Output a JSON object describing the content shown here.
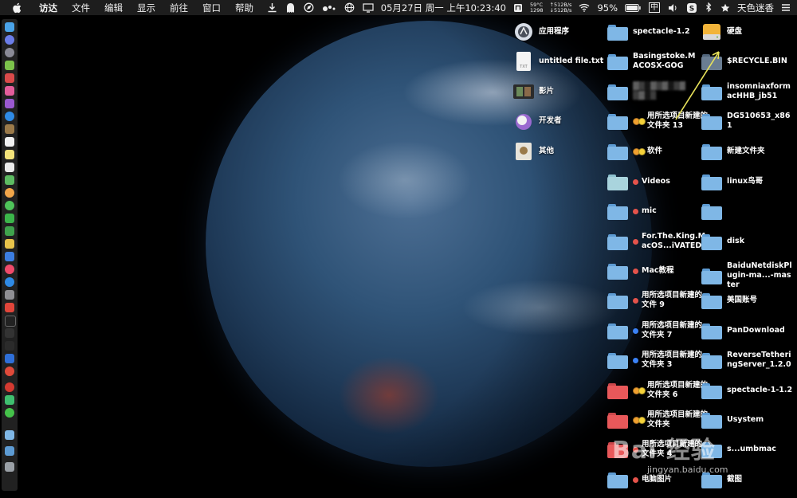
{
  "menubar": {
    "app_name": "访达",
    "menus": [
      "文件",
      "编辑",
      "显示",
      "前往",
      "窗口",
      "帮助"
    ],
    "temp_top": "59°C",
    "temp_bottom": "1298",
    "net_up": "↑512B/s",
    "net_down": "↓512B/s",
    "clock": "05月27日 周一 上午10:23:40",
    "battery_pct": "95%",
    "input_label": "中",
    "user": "天色迷香"
  },
  "colors": {
    "folder_blue": "#7fb7e6",
    "folder_blue_dark": "#5d9bd3",
    "folder_red": "#e8585a",
    "tag_red": "#e5534b",
    "tag_orange": "#f0a030",
    "tag_blue": "#3b82f6",
    "arrow": "#e8e25a"
  },
  "desktop": {
    "col1": [
      {
        "label": "应用程序",
        "icon": "applications-icon"
      },
      {
        "label": "untitled file.txt",
        "icon": "text-file-icon"
      },
      {
        "label": "影片",
        "icon": "movies-icon"
      },
      {
        "label": "开发者",
        "icon": "developer-icon"
      },
      {
        "label": "其他",
        "icon": "other-icon"
      }
    ],
    "col2": [
      {
        "label": "spectacle-1.2",
        "tag": ""
      },
      {
        "label": "Basingstoke.MACOSX-GOG",
        "tag": ""
      },
      {
        "label": "",
        "tag": ""
      },
      {
        "label": "用所选项目新建的文件夹 13",
        "tag": "orange-yellow"
      },
      {
        "label": "软件",
        "tag": "orange-yellow"
      },
      {
        "label": "Videos",
        "tag": "red"
      },
      {
        "label": "mic",
        "tag": "red"
      },
      {
        "label": "For.The.King.MacOS...iVATED",
        "tag": "red"
      },
      {
        "label": "Mac教程",
        "tag": "red"
      },
      {
        "label": "用所选项目新建的文件 9",
        "tag": "red"
      },
      {
        "label": "用所选项目新建的文件夹 7",
        "tag": "blue"
      },
      {
        "label": "用所选项目新建的文件夹 3",
        "tag": "blue"
      },
      {
        "label": "用所选项目新建的文件夹 6",
        "tag": "orange-yellow"
      },
      {
        "label": "用所选项目新建的文件夹",
        "tag": "orange-yellow"
      },
      {
        "label": "用所选项目新建的文件夹 4",
        "tag": "red"
      },
      {
        "label": "电脑图片",
        "tag": "red"
      }
    ],
    "col3": [
      {
        "label": "硬盘",
        "icon": "hard-drive-icon"
      },
      {
        "label": "$RECYCLE.BIN"
      },
      {
        "label": "insomniaxformacHHB_jb51"
      },
      {
        "label": "DG510653_x861"
      },
      {
        "label": "新建文件夹"
      },
      {
        "label": "linux鸟哥"
      },
      {
        "label": ""
      },
      {
        "label": "disk"
      },
      {
        "label": "BaiduNetdiskPlugin-ma...-master"
      },
      {
        "label": "美国账号"
      },
      {
        "label": "PanDownload"
      },
      {
        "label": "ReverseTetheringServer_1.2.0"
      },
      {
        "label": "spectacle-1-1.2"
      },
      {
        "label": "Usystem"
      },
      {
        "label": "s...umbmac"
      },
      {
        "label": "截图"
      }
    ]
  },
  "watermark": {
    "brand": "Bai 经验",
    "url": "jingyan.baidu.com"
  }
}
